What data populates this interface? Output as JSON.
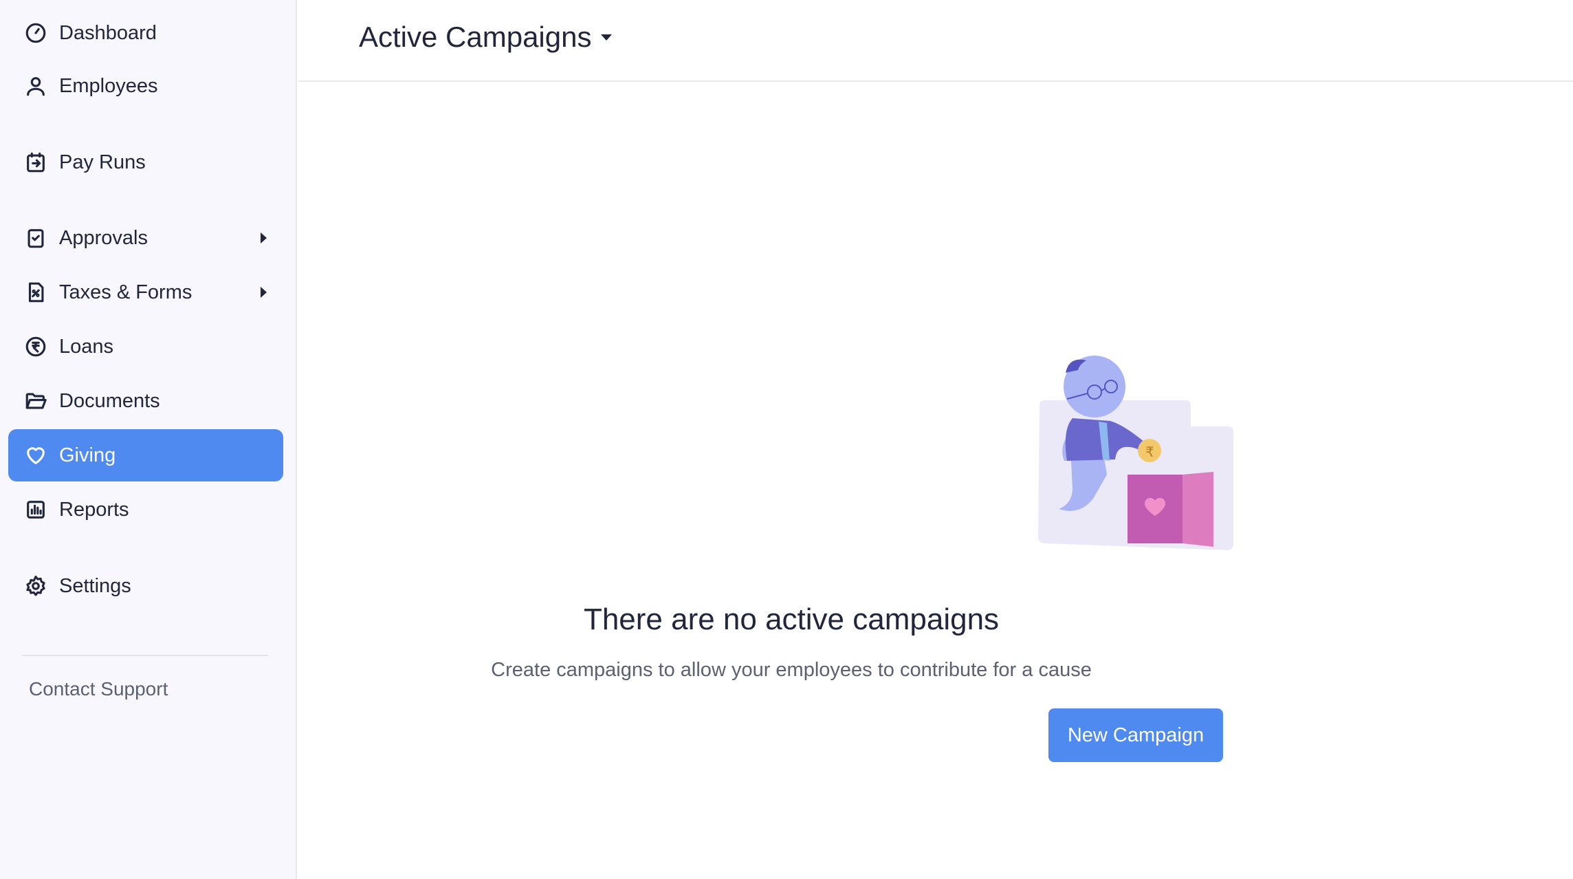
{
  "sidebar": {
    "items": [
      {
        "label": "Dashboard",
        "icon": "dashboard-gauge-icon"
      },
      {
        "label": "Employees",
        "icon": "user-icon"
      },
      {
        "label": "Pay Runs",
        "icon": "pay-runs-icon"
      },
      {
        "label": "Approvals",
        "icon": "approval-check-icon",
        "has_submenu": true
      },
      {
        "label": "Taxes & Forms",
        "icon": "tax-percent-icon",
        "has_submenu": true
      },
      {
        "label": "Loans",
        "icon": "rupee-coin-icon"
      },
      {
        "label": "Documents",
        "icon": "folder-icon"
      },
      {
        "label": "Giving",
        "icon": "heart-icon",
        "active": true
      },
      {
        "label": "Reports",
        "icon": "bar-chart-icon"
      },
      {
        "label": "Settings",
        "icon": "gear-icon"
      }
    ],
    "contact_support": "Contact Support"
  },
  "header": {
    "title": "Active Campaigns"
  },
  "empty_state": {
    "title": "There are no active campaigns",
    "subtitle": "Create campaigns to allow your employees to contribute for a cause",
    "button_label": "New Campaign",
    "illustration": "donation-box-illustration"
  },
  "colors": {
    "accent": "#4f8af0",
    "sidebar_bg": "#f7f7fd",
    "text": "#21263c",
    "muted_text": "#5b6072"
  }
}
